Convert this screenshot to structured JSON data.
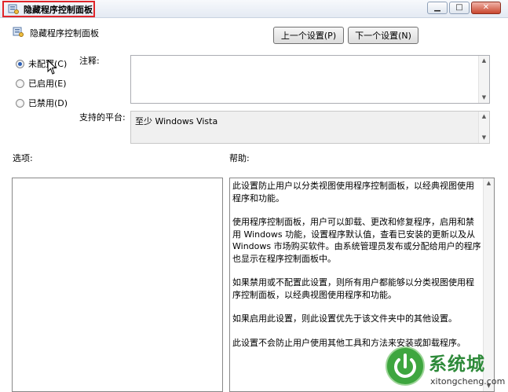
{
  "window": {
    "title": "隐藏程序控制面板",
    "min_symbol": "▁",
    "max_symbol": "□",
    "close_symbol": "✕",
    "highlight_color": "#e0262a"
  },
  "header": {
    "title": "隐藏程序控制面板",
    "prev_label": "上一个设置(P)",
    "next_label": "下一个设置(N)"
  },
  "radios": [
    {
      "label": "未配置(C)",
      "checked": true
    },
    {
      "label": "已启用(E)",
      "checked": false
    },
    {
      "label": "已禁用(D)",
      "checked": false
    }
  ],
  "comment": {
    "label": "注释:",
    "value": ""
  },
  "platform": {
    "label": "支持的平台:",
    "value": "至少 Windows Vista"
  },
  "options": {
    "label": "选项:"
  },
  "help": {
    "label": "帮助:",
    "paragraphs": [
      "此设置防止用户以分类视图使用程序控制面板，以经典视图使用程序和功能。",
      "使用程序控制面板，用户可以卸载、更改和修复程序，启用和禁用 Windows 功能，设置程序默认值，查看已安装的更新以及从 Windows 市场购买软件。由系统管理员发布或分配给用户的程序也显示在程序控制面板中。",
      "如果禁用或不配置此设置，则所有用户都能够以分类视图使用程序控制面板，以经典视图使用程序和功能。",
      "如果启用此设置，则此设置优先于该文件夹中的其他设置。",
      "此设置不会防止用户使用其他工具和方法来安装或卸载程序。"
    ]
  },
  "watermark": {
    "text": "系统城",
    "url": "xitongcheng.com"
  },
  "scroll": {
    "up": "▲",
    "down": "▼"
  }
}
